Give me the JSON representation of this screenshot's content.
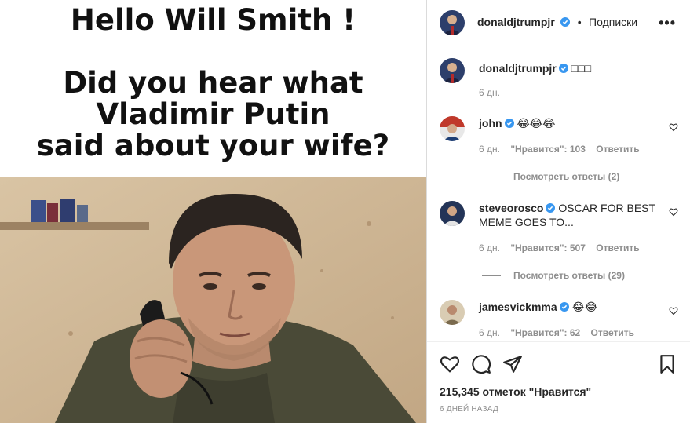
{
  "post": {
    "meme_line1": "Hello Will Smith !",
    "meme_line2a": "Did you hear what",
    "meme_line2b": "Vladimir Putin",
    "meme_line2c": "said about your wife?",
    "photo_icon": "man-on-phone-photo"
  },
  "header": {
    "username": "donaldjtrumpjr",
    "separator": "•",
    "follow_label": "Подписки",
    "more_icon": "more-options-icon"
  },
  "caption": {
    "username": "donaldjtrumpjr",
    "text": "□□□",
    "time": "6 дн."
  },
  "comments": [
    {
      "username": "john",
      "text": "😂😂😂",
      "time": "6 дн.",
      "likes": "\"Нравится\": 103",
      "reply": "Ответить",
      "view_replies": "Посмотреть ответы (2)",
      "avatar_color": "#c0392b"
    },
    {
      "username": "steveorosco",
      "text": "OSCAR FOR BEST MEME GOES TO...",
      "time": "6 дн.",
      "likes": "\"Нравится\": 507",
      "reply": "Ответить",
      "view_replies": "Посмотреть ответы (29)",
      "avatar_color": "#2c3e6b"
    },
    {
      "username": "jamesvickmma",
      "text": "😂😂",
      "time": "6 дн.",
      "likes": "\"Нравится\": 62",
      "reply": "Ответить",
      "avatar_color": "#b9a27c"
    }
  ],
  "actions": {
    "like_icon": "heart-icon",
    "comment_icon": "comment-icon",
    "share_icon": "share-icon",
    "save_icon": "bookmark-icon"
  },
  "likes_text": "215,345 отметок \"Нравится\"",
  "date_text": "6 ДНЕЙ НАЗАД",
  "colors": {
    "verified": "#3897f0",
    "muted": "#8e8e8e",
    "text": "#262626"
  }
}
